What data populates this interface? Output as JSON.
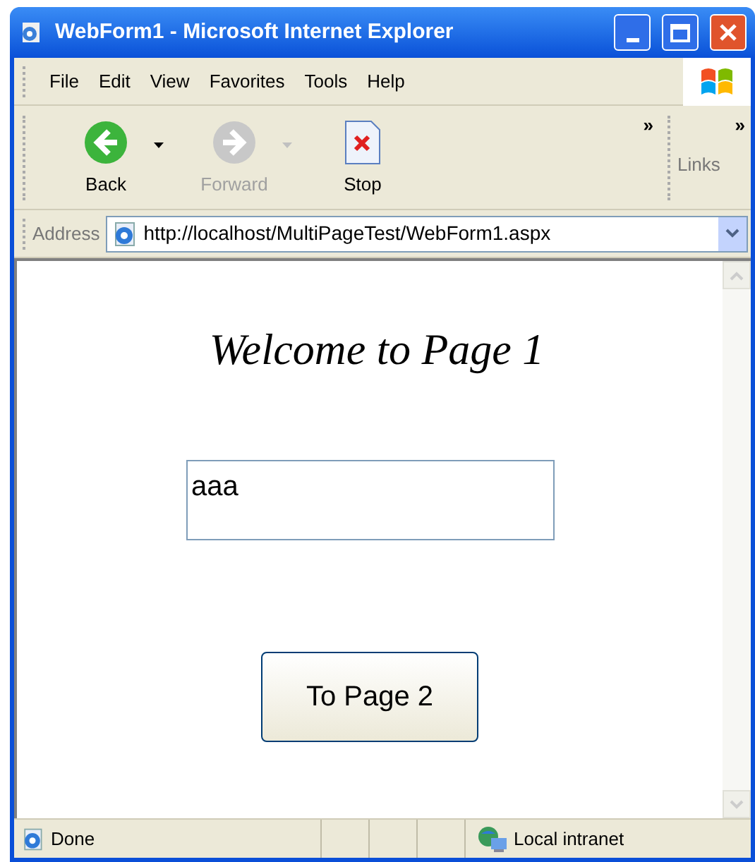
{
  "window": {
    "title": "WebForm1 - Microsoft Internet Explorer"
  },
  "menu": [
    "File",
    "Edit",
    "View",
    "Favorites",
    "Tools",
    "Help"
  ],
  "toolbar": [
    {
      "kind": "back",
      "label": "Back",
      "disabled": false
    },
    {
      "kind": "forward",
      "label": "Forward",
      "disabled": true
    },
    {
      "kind": "stop",
      "label": "Stop",
      "disabled": false
    }
  ],
  "chevron": "»",
  "links": {
    "chevron": "»",
    "label": "Links"
  },
  "address": {
    "label": "Address",
    "value": "http://localhost/MultiPageTest/WebForm1.aspx"
  },
  "page": {
    "heading": "Welcome to Page 1",
    "field_value": "aaa",
    "button": "To Page 2"
  },
  "status_bar": {
    "text": "Done",
    "zone": "Local intranet"
  }
}
